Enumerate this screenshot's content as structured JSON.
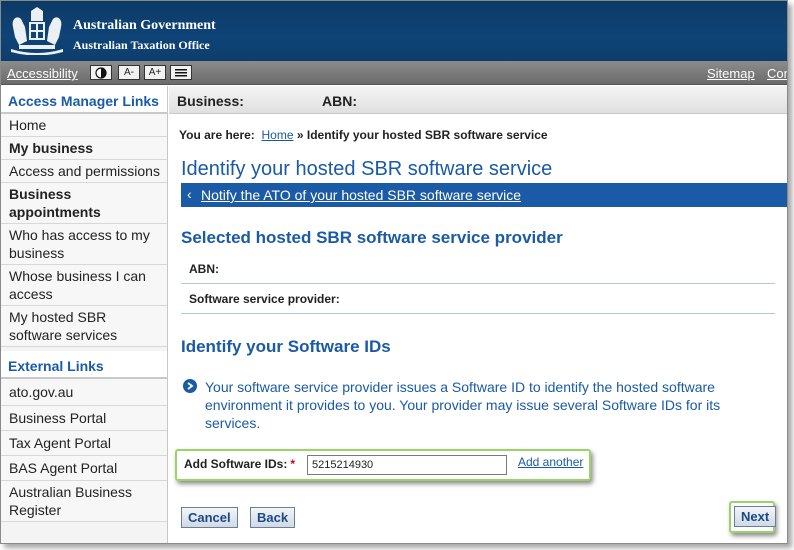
{
  "header": {
    "gov_line": "Australian Government",
    "agency_line": "Australian Taxation Office"
  },
  "utility": {
    "accessibility": "Accessibility",
    "contrast_icon": "contrast-icon",
    "text_smaller": "A-",
    "text_larger": "A+",
    "text_only_icon": "text-only-icon",
    "sitemap": "Sitemap",
    "contact": "Con"
  },
  "sidebar": {
    "heading": "Access Manager Links",
    "items": [
      {
        "label": "Home",
        "bold": false
      },
      {
        "label": "My business",
        "bold": true
      },
      {
        "label": "Access and permissions",
        "bold": false
      },
      {
        "label": "Business appointments",
        "bold": true
      },
      {
        "label": "Who has access to my business",
        "bold": false
      },
      {
        "label": "Whose business I can access",
        "bold": false
      },
      {
        "label": "My hosted SBR software services",
        "bold": false
      }
    ],
    "external_heading": "External Links",
    "external_items": [
      {
        "label": "ato.gov.au"
      },
      {
        "label": "Business Portal"
      },
      {
        "label": "Tax Agent Portal"
      },
      {
        "label": "BAS Agent Portal"
      },
      {
        "label": "Australian Business Register"
      }
    ]
  },
  "business_bar": {
    "business_label": "Business:",
    "abn_label": "ABN:"
  },
  "breadcrumb": {
    "prefix": "You are here:",
    "home": "Home",
    "separator": "»",
    "current": "Identify your hosted SBR software service"
  },
  "page": {
    "title": "Identify your hosted SBR software service",
    "notify_link": "Notify the ATO of your hosted SBR software service",
    "provider_heading": "Selected hosted SBR software service provider",
    "abn_field": "ABN:",
    "provider_field": "Software service provider:",
    "ids_heading": "Identify your Software IDs",
    "info_text": "Your software service provider issues a Software ID to identify the hosted software environment it provides to you. Your provider may issue several Software IDs for its services.",
    "software_ids": {
      "label": "Add Software IDs:",
      "required_mark": "*",
      "value": "5215214930",
      "add_another": "Add another"
    }
  },
  "buttons": {
    "cancel": "Cancel",
    "back": "Back",
    "next": "Next"
  },
  "colors": {
    "banner": "#0f4478",
    "link_blue": "#1a5aa6",
    "highlight_green": "#9ad36a",
    "required_red": "#d0021b"
  }
}
